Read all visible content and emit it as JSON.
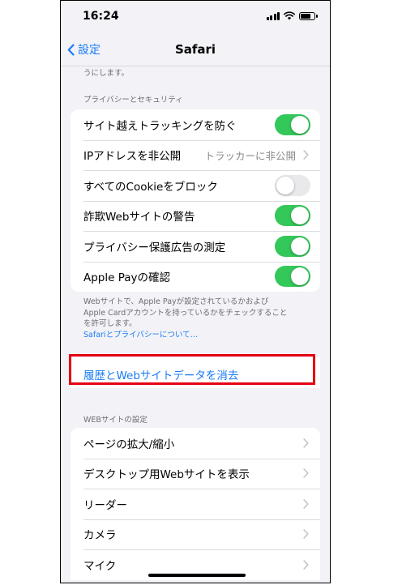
{
  "status_bar": {
    "time": "16:24"
  },
  "navbar": {
    "back_label": "設定",
    "title": "Safari"
  },
  "partial_text": "うにします。",
  "privacy_section": {
    "header": "プライバシーとセキュリティ",
    "rows": [
      {
        "label": "サイト越えトラッキングを防ぐ",
        "toggle": true
      },
      {
        "label": "IPアドレスを非公開",
        "value": "トラッカーに非公開"
      },
      {
        "label": "すべてのCookieをブロック",
        "toggle": false
      },
      {
        "label": "詐欺Webサイトの警告",
        "toggle": true
      },
      {
        "label": "プライバシー保護広告の測定",
        "toggle": true
      },
      {
        "label": "Apple Payの確認",
        "toggle": true
      }
    ],
    "footer_line1": "Webサイトで、Apple Payが設定されているかおよび",
    "footer_line2": "Apple Cardアカウントを持っているかをチェックすること",
    "footer_line3": "を許可します。",
    "footer_link": "Safariとプライバシーについて…"
  },
  "clear_history": {
    "label": "履歴とWebサイトデータを消去"
  },
  "website_section": {
    "header": "WEBサイトの設定",
    "rows": [
      {
        "label": "ページの拡大/縮小"
      },
      {
        "label": "デスクトップ用Webサイトを表示"
      },
      {
        "label": "リーダー"
      },
      {
        "label": "カメラ"
      },
      {
        "label": "マイク"
      }
    ]
  },
  "colors": {
    "accent": "#1a7cf5",
    "toggle_on": "#34c759",
    "highlight": "#e60012"
  }
}
